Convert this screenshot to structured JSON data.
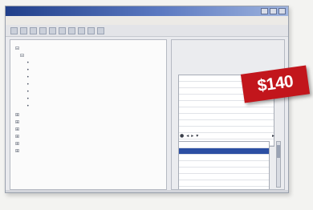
{
  "window": {
    "title": "",
    "menu": [
      "",
      "",
      "",
      "",
      "",
      ""
    ]
  },
  "tree": {
    "items": [
      {
        "label": ""
      },
      {
        "label": ""
      },
      {
        "label": ""
      },
      {
        "label": ""
      },
      {
        "label": ""
      },
      {
        "label": ""
      },
      {
        "label": ""
      },
      {
        "label": ""
      },
      {
        "label": ""
      },
      {
        "label": ""
      },
      {
        "label": ""
      },
      {
        "label": ""
      },
      {
        "label": ""
      },
      {
        "label": ""
      },
      {
        "label": ""
      }
    ]
  },
  "properties": {
    "header": "",
    "rows": [
      "",
      "",
      ""
    ]
  },
  "grid_top": {
    "rows": [
      "",
      "",
      "",
      "",
      "",
      "",
      "",
      "",
      "",
      "",
      ""
    ]
  },
  "grid_bottom": {
    "rows": [
      "",
      "",
      "",
      "",
      "",
      "",
      "",
      "",
      "",
      ""
    ]
  },
  "price": {
    "label": "$140",
    "tag_color": "#c2161c"
  }
}
